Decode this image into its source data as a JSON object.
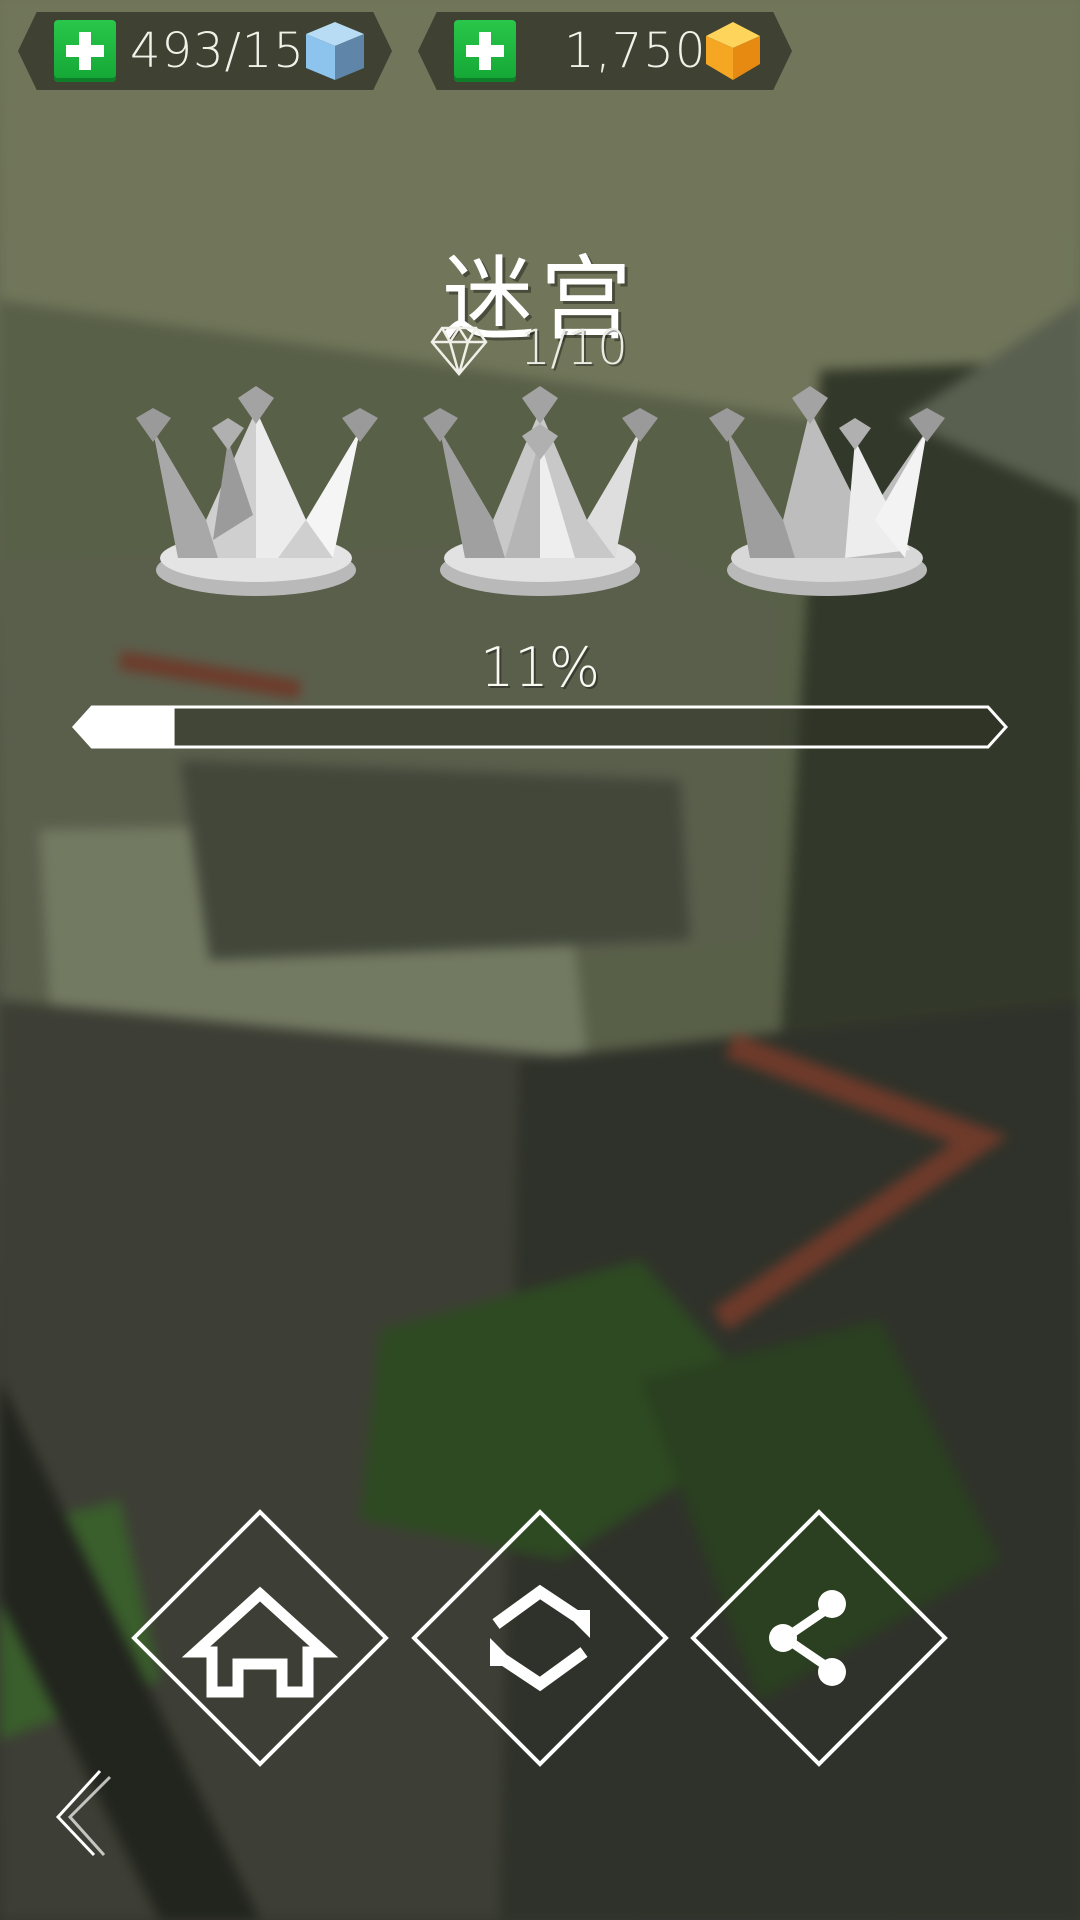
{
  "hud": {
    "energy": {
      "value": "493/15",
      "plus_icon": "plus-icon",
      "icon": "blue-cube-icon",
      "icon_color": "#8cc4ee"
    },
    "coins": {
      "value": "1,750",
      "plus_icon": "plus-icon",
      "icon": "gold-gem-icon",
      "icon_color": "#f5a623"
    }
  },
  "level": {
    "title": "迷宫",
    "gems": "1/10",
    "gem_icon": "diamond-outline-icon",
    "crowns": [
      {
        "icon": "crown-icon",
        "earned": false
      },
      {
        "icon": "crown-icon",
        "earned": false
      },
      {
        "icon": "crown-icon",
        "earned": false
      }
    ],
    "progress_label": "11%",
    "progress_value": 0.11
  },
  "actions": {
    "home": {
      "icon": "home-icon"
    },
    "restart": {
      "icon": "restart-icon"
    },
    "share": {
      "icon": "share-icon"
    },
    "back": {
      "icon": "back-chevron-icon"
    }
  },
  "colors": {
    "accent_green": "#1fb840",
    "progress_fill": "#ffffff",
    "outline": "#ffffff"
  }
}
